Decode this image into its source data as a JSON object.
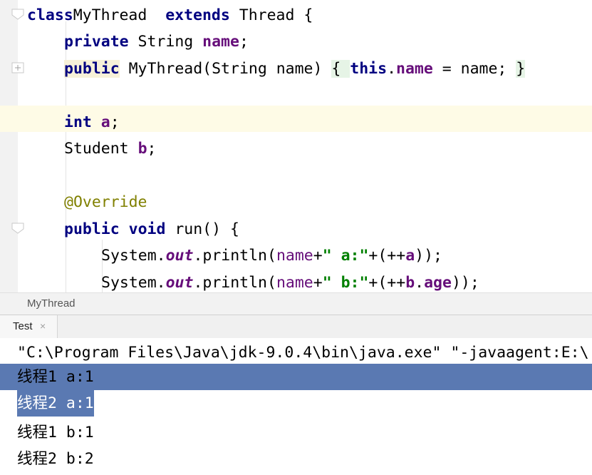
{
  "editor": {
    "lines": [
      {
        "parts": [
          [
            "kw",
            "class"
          ],
          [
            "",
            "MyThread "
          ],
          [
            "kw",
            "extends"
          ],
          [
            "",
            "Thread {"
          ]
        ]
      },
      {
        "parts": [
          [
            "kw",
            "private"
          ],
          [
            "",
            " String "
          ],
          [
            "fld",
            "name"
          ],
          [
            "",
            ";"
          ]
        ]
      },
      {
        "parts": [
          [
            "kw",
            "public"
          ],
          [
            "",
            " MyThread(String name) "
          ],
          [
            "",
            "{ "
          ],
          [
            "kw",
            "this"
          ],
          [
            "",
            "."
          ],
          [
            "fld",
            "name"
          ],
          [
            "",
            " = name; "
          ],
          [
            "",
            "}"
          ]
        ]
      },
      {
        "parts": []
      },
      {
        "parts": [
          [
            "kw",
            "int"
          ],
          [
            "",
            " "
          ],
          [
            "fld",
            "a"
          ],
          [
            "",
            ";"
          ]
        ]
      },
      {
        "parts": [
          [
            "",
            "Student "
          ],
          [
            "fld",
            "b"
          ],
          [
            "",
            ";"
          ]
        ]
      },
      {
        "parts": []
      },
      {
        "parts": [
          [
            "ann",
            "@Override"
          ]
        ]
      },
      {
        "parts": [
          [
            "kw",
            "public"
          ],
          [
            "",
            " "
          ],
          [
            "kw",
            "void"
          ],
          [
            "",
            " run() {"
          ]
        ]
      },
      {
        "parts": [
          [
            "",
            "System."
          ],
          [
            "static",
            "out"
          ],
          [
            "",
            ".println("
          ],
          [
            "fld-n",
            "name"
          ],
          [
            "",
            "+"
          ],
          [
            "str",
            "\" a:\""
          ],
          [
            "",
            "+(++"
          ],
          [
            "fld",
            "a"
          ],
          [
            "",
            "));"
          ]
        ]
      },
      {
        "parts": [
          [
            "",
            "System."
          ],
          [
            "static",
            "out"
          ],
          [
            "",
            ".println("
          ],
          [
            "fld-n",
            "name"
          ],
          [
            "",
            "+"
          ],
          [
            "str",
            "\" b:\""
          ],
          [
            "",
            "+(++"
          ],
          [
            "fld",
            "b"
          ],
          [
            "",
            "."
          ],
          [
            "fld",
            "age"
          ],
          [
            "",
            "));"
          ]
        ]
      }
    ]
  },
  "breadcrumb": {
    "label": "MyThread"
  },
  "run_panel": {
    "tab_label": "Test",
    "close_glyph": "×",
    "output": [
      "\"C:\\Program Files\\Java\\jdk-9.0.4\\bin\\java.exe\" \"-javaagent:E:\\",
      "线程1 a:1",
      "线程2 a:1",
      "线程1 b:1",
      "线程2 b:2"
    ]
  },
  "colors": {
    "keyword": "#000080",
    "field": "#660e7a",
    "string": "#008000",
    "annotation": "#808000",
    "selection": "#5a79b2",
    "current_line": "#fefbe6"
  }
}
